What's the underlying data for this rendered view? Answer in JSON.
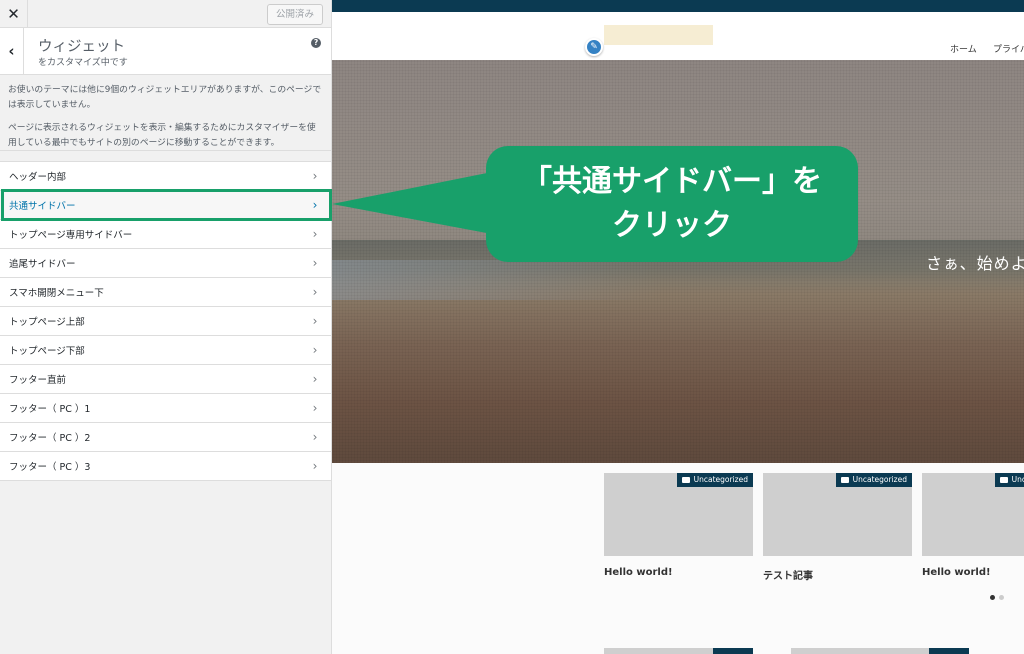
{
  "panel": {
    "close_label": "✕",
    "publish_label": "公開済み",
    "section": {
      "title": "ウィジェット",
      "subtitle": "をカスタマイズ中です",
      "help_label": "?"
    },
    "description": [
      "お使いのテーマには他に9個のウィジェットエリアがありますが、このページでは表示していません。",
      "ページに表示されるウィジェットを表示・編集するためにカスタマイザーを使用している最中でもサイトの別のページに移動することができます。"
    ],
    "widget_areas": [
      "ヘッダー内部",
      "共通サイドバー",
      "トップページ専用サイドバー",
      "追尾サイドバー",
      "スマホ開閉メニュー下",
      "トップページ上部",
      "トップページ下部",
      "フッター直前",
      "フッター（ PC ）1",
      "フッター（ PC ）2",
      "フッター（ PC ）3"
    ],
    "active_index": 1
  },
  "preview": {
    "nav": {
      "home": "ホーム",
      "privacy": "プライバ"
    },
    "hero_text": "さぁ、始めよ",
    "posts": [
      {
        "category": "Uncategorized",
        "title": "Hello world!"
      },
      {
        "category": "Uncategorized",
        "title": "テスト記事"
      },
      {
        "category": "Uncategorized",
        "title": "Hello world!"
      }
    ]
  },
  "callout": {
    "line1": "「共通サイドバー」を",
    "line2": "クリック",
    "color": "#18a06a"
  },
  "colors": {
    "top_bar": "#0b3a52",
    "accent_blue": "#0073aa",
    "edit_icon": "#3582c4"
  }
}
